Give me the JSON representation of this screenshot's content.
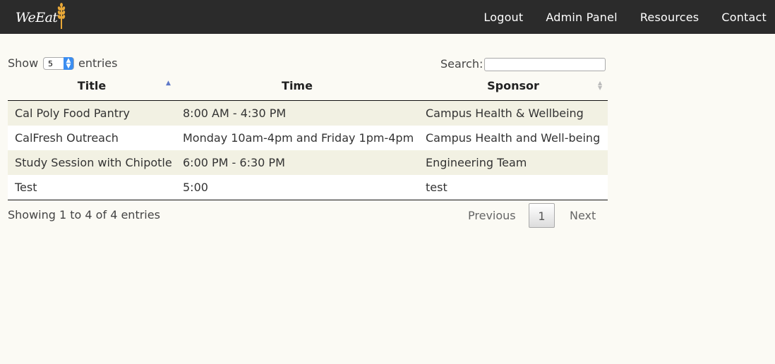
{
  "brand": {
    "logo_text": "WeEat",
    "logo_icon": "wheat-icon",
    "accent": "#e8a838"
  },
  "nav": {
    "items": [
      "Logout",
      "Admin Panel",
      "Resources",
      "Contact"
    ]
  },
  "controls": {
    "show_label": "Show",
    "page_length": "5",
    "entries_label": "entries",
    "search_label": "Search:",
    "search_value": ""
  },
  "table": {
    "headers": [
      "Title",
      "Time",
      "Sponsor"
    ],
    "sort": {
      "column": "Title",
      "direction": "ascending"
    },
    "rows": [
      [
        "Cal Poly Food Pantry",
        "8:00 AM - 4:30 PM",
        "Campus Health & Wellbeing"
      ],
      [
        "CalFresh Outreach",
        "Monday 10am-4pm and Friday 1pm-4pm",
        "Campus Health and Well-being"
      ],
      [
        "Study Session with Chipotle",
        "6:00 PM - 6:30 PM",
        "Engineering Team"
      ],
      [
        "Test",
        "5:00",
        "test"
      ]
    ]
  },
  "footer": {
    "info": "Showing 1 to 4 of 4 entries",
    "previous": "Previous",
    "current_page": "1",
    "next": "Next"
  },
  "colors": {
    "navbar": "#2b2b2b",
    "background": "#fbfaf4",
    "row_stripe": "#f2f1e3"
  }
}
